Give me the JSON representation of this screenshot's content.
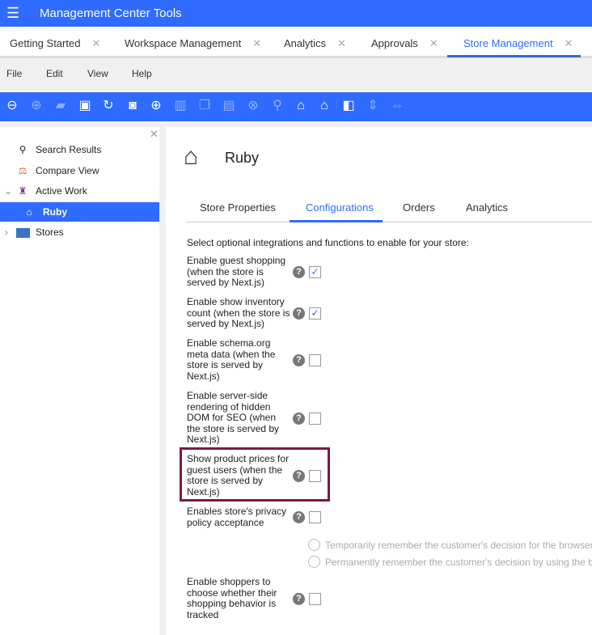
{
  "app": {
    "title": "Management Center Tools"
  },
  "tabs": [
    {
      "label": "Getting Started"
    },
    {
      "label": "Workspace Management"
    },
    {
      "label": "Analytics"
    },
    {
      "label": "Approvals"
    },
    {
      "label": "Store Management",
      "active": true
    }
  ],
  "menu": [
    "File",
    "Edit",
    "View",
    "Help"
  ],
  "toolbar": [
    "back",
    "forward",
    "open-folder",
    "save",
    "refresh",
    "stop",
    "globe",
    "split",
    "copy",
    "paste",
    "cancel",
    "find",
    "store-new",
    "store-settings",
    "panel-left",
    "collapse-vertical",
    "collapse-horizontal"
  ],
  "sidebar": {
    "items": [
      {
        "label": "Search Results",
        "icon": "search-icon"
      },
      {
        "label": "Compare View",
        "icon": "scale-icon"
      },
      {
        "label": "Active Work",
        "icon": "lamp-icon"
      },
      {
        "label": "Ruby",
        "icon": "store-icon",
        "selected": true
      },
      {
        "label": "Stores",
        "icon": "folder-icon"
      }
    ]
  },
  "store": {
    "name": "Ruby"
  },
  "content_tabs": [
    {
      "label": "Store Properties"
    },
    {
      "label": "Configurations",
      "active": true
    },
    {
      "label": "Orders"
    },
    {
      "label": "Analytics"
    }
  ],
  "intro": "Select optional integrations and functions to enable for your store:",
  "options": [
    {
      "label": "Enable guest shopping (when the store is served by Next.js)",
      "checked": true
    },
    {
      "label": "Enable show inventory count (when the store is served by Next.js)",
      "checked": true
    },
    {
      "label": "Enable schema.org meta data (when the store is served by Next.js)",
      "checked": false
    },
    {
      "label": "Enable server-side rendering of hidden DOM for SEO (when the store is served by Next.js)",
      "checked": false
    },
    {
      "label": "Show product prices for guest users (when the store is served by Next.js)",
      "checked": false,
      "highlighted": true
    },
    {
      "label": "Enables store's privacy policy acceptance",
      "checked": false
    },
    {
      "label": "Enable shoppers to choose whether their shopping behavior is tracked",
      "checked": false
    }
  ],
  "privacy_radios": [
    "Temporarily remember the customer's decision for the browser s",
    "Permanently remember the customer's decision by using the bro"
  ],
  "colors": {
    "brand": "#2f6bff",
    "highlight": "#7a1a45"
  }
}
